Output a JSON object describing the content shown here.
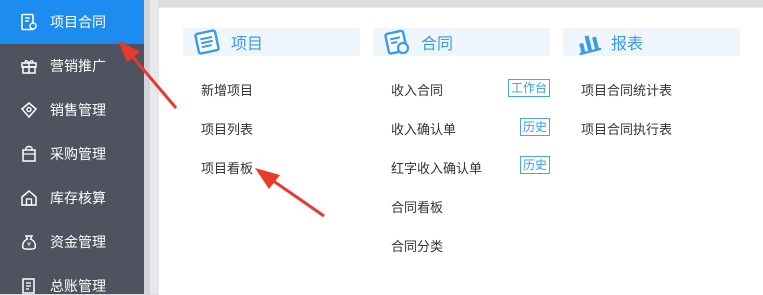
{
  "sidebar": {
    "items": [
      {
        "label": "项目合同",
        "icon": "contract-icon",
        "active": true
      },
      {
        "label": "营销推广",
        "icon": "gift-icon"
      },
      {
        "label": "销售管理",
        "icon": "sales-icon"
      },
      {
        "label": "采购管理",
        "icon": "cart-icon"
      },
      {
        "label": "库存核算",
        "icon": "warehouse-icon"
      },
      {
        "label": "资金管理",
        "icon": "money-bag-icon"
      },
      {
        "label": "总账管理",
        "icon": "ledger-icon"
      }
    ]
  },
  "columns": {
    "project": {
      "title": "项目",
      "links": [
        "新增项目",
        "项目列表",
        "项目看板"
      ]
    },
    "contract": {
      "title": "合同",
      "links": [
        "收入合同",
        "收入确认单",
        "红字收入确认单",
        "合同看板",
        "合同分类"
      ],
      "badges": [
        "工作台",
        "历史",
        "历史"
      ]
    },
    "report": {
      "title": "报表",
      "links": [
        "项目合同统计表",
        "项目合同执行表"
      ]
    }
  },
  "colors": {
    "sidebar_bg": "#4e535f",
    "active_bg": "#1c8cf0",
    "accent": "#3a9bec",
    "header_bg": "#eef5fb",
    "annotation": "#e83a2a"
  }
}
